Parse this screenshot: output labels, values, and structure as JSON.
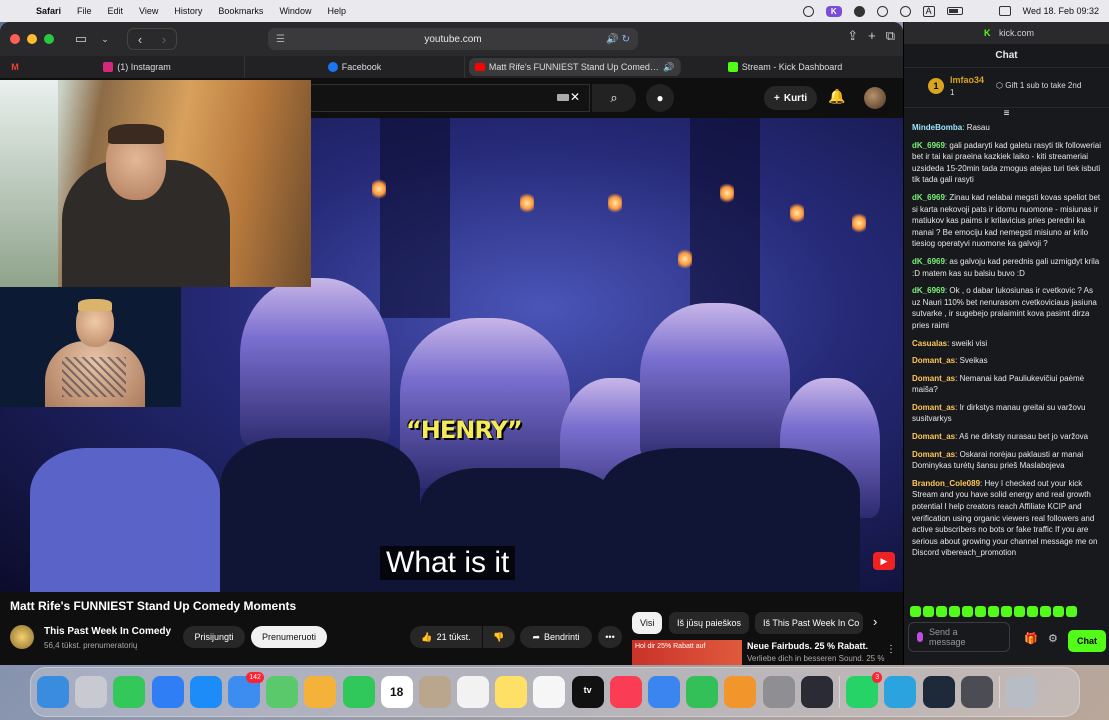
{
  "menubar": {
    "app": "Safari",
    "items": [
      "File",
      "Edit",
      "View",
      "History",
      "Bookmarks",
      "Window",
      "Help"
    ],
    "datetime": "Wed 18. Feb 09:32"
  },
  "safari": {
    "url": "youtube.com",
    "tabs": [
      {
        "label": "(1) Instagram",
        "color": "#d6287b"
      },
      {
        "label": "Facebook",
        "color": "#1877f2"
      },
      {
        "label": "Matt Rife's FUNNIEST Stand Up Comed…",
        "color": "#ff0000"
      },
      {
        "label": "Stream - Kick Dashboard",
        "color": "#53fc18"
      }
    ]
  },
  "youtube": {
    "create_label": "Kurti",
    "video_overlay_text": "“HENRY”",
    "caption": "What is it",
    "title": "Matt Rife's FUNNIEST Stand Up Comedy Moments",
    "channel": "This Past Week In Comedy",
    "subscribers": "56,4 tūkst. prenumeratorių",
    "join_label": "Prisijungti",
    "subscribe_label": "Prenumeruoti",
    "likes": "21 tūkst.",
    "share_label": "Bendrinti",
    "chips": [
      "Visi",
      "Iš jūsų paieškos",
      "Iš This Past Week In Co"
    ],
    "ad": {
      "thumb_text": "Hol dir 25% Rabatt auf",
      "title": "Neue Fairbuds. 25 % Rabatt.",
      "subtitle": "Verliebe dich in besseren Sound. 25 %"
    }
  },
  "kick": {
    "url": "kick.com",
    "header": "Chat",
    "gift": {
      "rank": "1",
      "user": "lmfao34",
      "count": "1",
      "cta": "Gift 1 sub to take 2nd"
    },
    "messages": [
      {
        "user": "MindeBomba",
        "color": "#9be7ff",
        "text": "Rasau"
      },
      {
        "user": "dK_6969",
        "color": "#7cf07c",
        "text": "gali padaryti kad galetu rasyti tik followeriai bet ir tai kai praeina kazkiek laiko - kiti streameriai uzsideda 15-20min tada zmogus atejas turi tiek isbuti tik tada gali rasyti"
      },
      {
        "user": "dK_6969",
        "color": "#7cf07c",
        "text": "Zinau kad nelabai megsti kovas speliot bet si karta nekovoji pats ir idomu nuomone - misiunas ir matiukov kas paims ir krilavicius pries peredni ka manai ? Be emociju kad nemegsti misiuno ar krilo tiesiog operatyvi nuomone ka galvoji ?"
      },
      {
        "user": "dK_6969",
        "color": "#7cf07c",
        "text": "as galvoju kad perednis gali uzmigdyt krila :D matem kas su balsiu buvo :D"
      },
      {
        "user": "dK_6969",
        "color": "#7cf07c",
        "text": "Ok , o dabar lukosiunas ir cvetkovic ? As uz Nauri 110% bet nenurasom cvetkoviciaus jasiuna sutvarke , ir sugebejo pralaimint kova pasimt dirza pries raimi"
      },
      {
        "user": "Casualas",
        "color": "#ffc857",
        "text": "sweiki visi"
      },
      {
        "user": "Domant_as",
        "color": "#ffc857",
        "text": "Sveikas"
      },
      {
        "user": "Domant_as",
        "color": "#ffc857",
        "text": "Nemanai kad Pauliukevičiui paėmė maiša?"
      },
      {
        "user": "Domant_as",
        "color": "#ffc857",
        "text": "Ir dirkstys manau greitai su varžovu susitvarkys"
      },
      {
        "user": "Domant_as",
        "color": "#ffc857",
        "text": "Aš ne dirksty nurasau bet jo varžova"
      },
      {
        "user": "Domant_as",
        "color": "#ffc857",
        "text": "Oskarai norėjau paklausti ar manai Dominykas turėtų šansu prieš Maslabojeva"
      },
      {
        "user": "Brandon_Cole089",
        "color": "#ffc857",
        "text": "Hey I checked out your kick Stream and you have solid energy and real growth potential I help creators reach Affiliate KCIP and verification using organic viewers real followers and active subscribers no bots or fake traffic If you are serious about growing your channel message me on Discord vibereach_promotion"
      }
    ],
    "input_placeholder": "Send a message",
    "chat_button": "Chat"
  },
  "dock": {
    "apps": [
      {
        "name": "finder",
        "color": "#3a8dde"
      },
      {
        "name": "launchpad",
        "color": "#c9c9d2"
      },
      {
        "name": "messages",
        "color": "#34c759"
      },
      {
        "name": "safari",
        "color": "#2f7ef5"
      },
      {
        "name": "app-store",
        "color": "#1d8cf8"
      },
      {
        "name": "mail",
        "color": "#3d8cf0",
        "badge": "142"
      },
      {
        "name": "maps",
        "color": "#5ac96b"
      },
      {
        "name": "photos",
        "color": "#f4b23b"
      },
      {
        "name": "facetime",
        "color": "#30c85a"
      },
      {
        "name": "calendar",
        "color": "#ffffff",
        "label": "18"
      },
      {
        "name": "contacts",
        "color": "#b9a68d"
      },
      {
        "name": "reminders",
        "color": "#f2f2f2"
      },
      {
        "name": "notes",
        "color": "#ffe066"
      },
      {
        "name": "freeform",
        "color": "#f6f6f6"
      },
      {
        "name": "tv",
        "color": "#111111",
        "label": "tv"
      },
      {
        "name": "music",
        "color": "#fa3c55"
      },
      {
        "name": "keynote",
        "color": "#3b85f0"
      },
      {
        "name": "numbers",
        "color": "#33c059"
      },
      {
        "name": "pages",
        "color": "#f2962b"
      },
      {
        "name": "system-settings",
        "color": "#8e8e93"
      },
      {
        "name": "obs",
        "color": "#2b2b35"
      },
      {
        "name": "whatsapp",
        "color": "#25d366",
        "badge": "3"
      },
      {
        "name": "telegram",
        "color": "#2aa3df"
      },
      {
        "name": "league",
        "color": "#1e2a3a"
      },
      {
        "name": "preview",
        "color": "#4c4c55"
      },
      {
        "name": "trash",
        "color": "#b8bcc4"
      }
    ]
  }
}
